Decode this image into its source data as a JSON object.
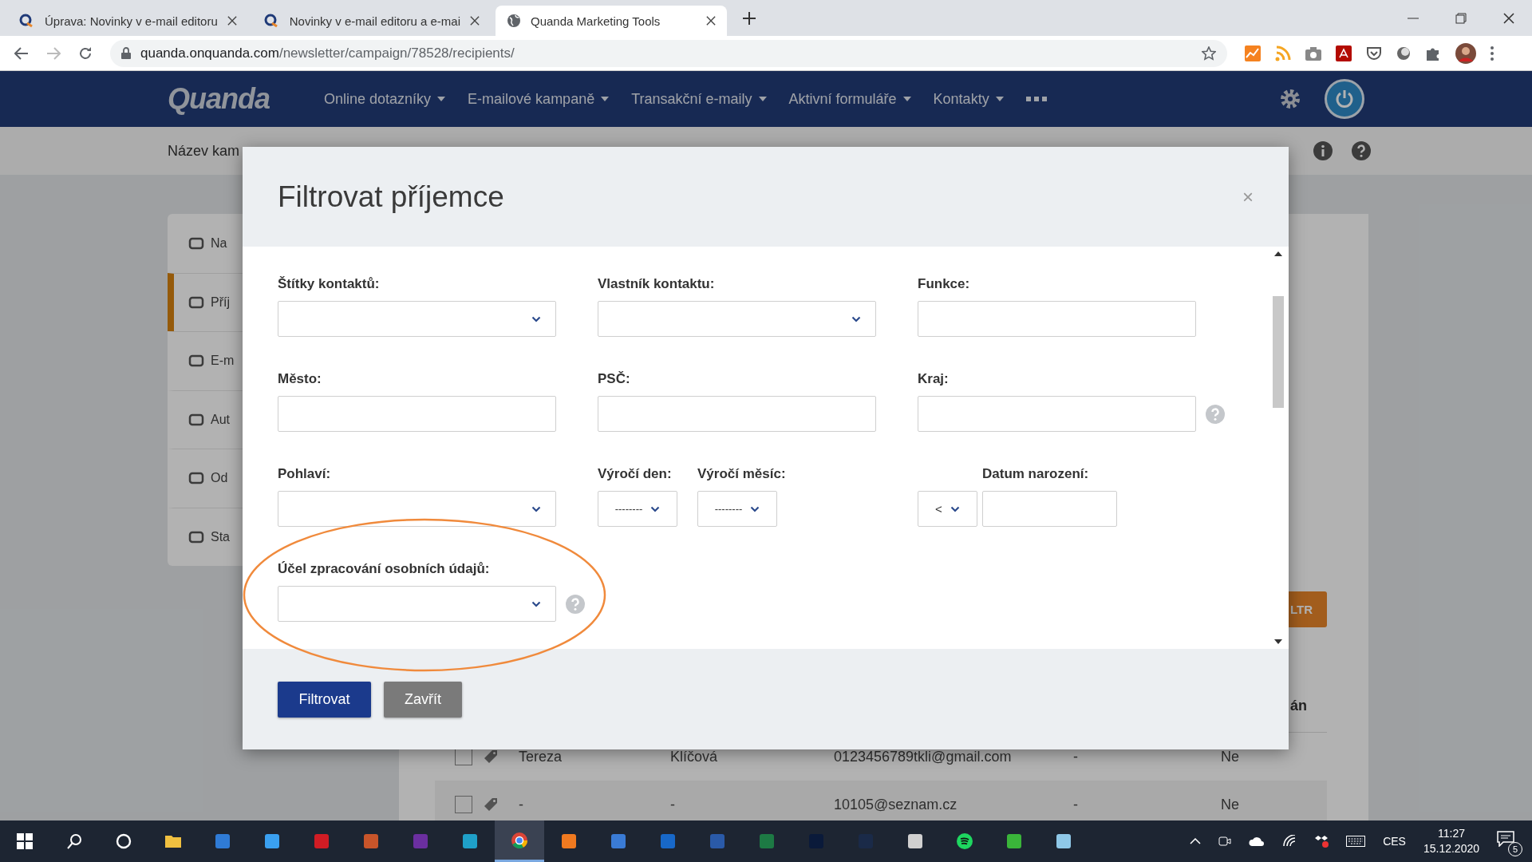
{
  "browser": {
    "tabs": [
      {
        "title": "Úprava: Novinky v e-mail editoru",
        "selected": false
      },
      {
        "title": "Novinky v e-mail editoru a e-mai",
        "selected": false
      },
      {
        "title": "Quanda Marketing Tools",
        "selected": true
      }
    ],
    "address": {
      "host": "quanda.onquanda.com",
      "path": "/newsletter/campaign/78528/recipients/"
    }
  },
  "navbar": {
    "logo": "Quanda",
    "menu": [
      "Online dotazníky",
      "E-mailové kampaně",
      "Transakční e-maily",
      "Aktivní formuláře",
      "Kontakty"
    ]
  },
  "subheader": {
    "campaign_label": "Název kam"
  },
  "sidebar": {
    "items": [
      {
        "label": "Na",
        "selected": false
      },
      {
        "label": "Příj",
        "selected": true
      },
      {
        "label": "E-m",
        "selected": false
      },
      {
        "label": "Aut",
        "selected": false
      },
      {
        "label": "Od",
        "selected": false
      },
      {
        "label": "Sta",
        "selected": false
      }
    ]
  },
  "filter_button": "LTR",
  "table": {
    "column_5_header": "án",
    "rows": [
      {
        "cells": [
          "Tereza",
          "Klíčová",
          "0123456789tkli@gmail.com",
          "-",
          "Ne"
        ],
        "checked": false
      },
      {
        "cells": [
          "-",
          "-",
          "10105@seznam.cz",
          "-",
          "Ne"
        ],
        "checked": false
      }
    ]
  },
  "modal": {
    "title": "Filtrovat příjemce",
    "close": "×",
    "fields": [
      {
        "kind": "select",
        "label": "Štítky kontaktů:",
        "help": false,
        "highlighted": false
      },
      {
        "kind": "select",
        "label": "Vlastník kontaktu:",
        "help": false,
        "highlighted": false
      },
      {
        "kind": "text",
        "label": "Funkce:",
        "help": false,
        "highlighted": false
      },
      {
        "kind": "text",
        "label": "Město:",
        "help": false,
        "highlighted": false
      },
      {
        "kind": "text",
        "label": "PSČ:",
        "help": false,
        "highlighted": false
      },
      {
        "kind": "text",
        "label": "Kraj:",
        "help": true,
        "highlighted": false
      },
      {
        "kind": "select",
        "label": "Pohlaví:",
        "help": false,
        "highlighted": false
      },
      {
        "kind": "anniversary",
        "day_label": "Výročí den:",
        "day_value": "--------",
        "month_label": "Výročí měsíc:",
        "month_value": "--------",
        "help": false,
        "highlighted": false
      },
      {
        "kind": "birthdate",
        "label": "Datum narození:",
        "operator": "<",
        "help": false,
        "highlighted": false
      },
      {
        "kind": "select",
        "label": "Účel zpracování osobních údajů:",
        "help": true,
        "highlighted": true
      }
    ],
    "buttons": [
      {
        "label": "Filtrovat",
        "kind": "primary"
      },
      {
        "label": "Zavřít",
        "kind": "secondary"
      }
    ]
  },
  "taskbar": {
    "language": "CES",
    "time": "11:27",
    "date": "15.12.2020",
    "notifications": "5"
  }
}
